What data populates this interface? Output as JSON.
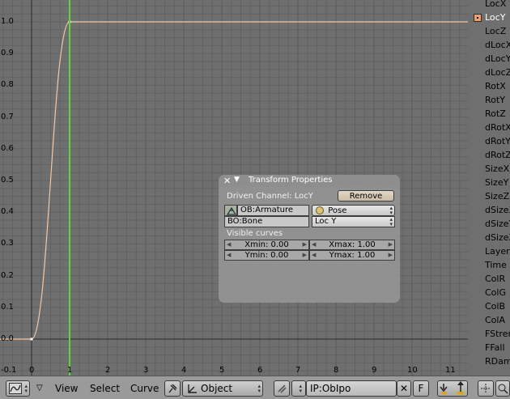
{
  "graph": {
    "y_ticks": [
      "1.0",
      "0.9",
      "0.8",
      "0.7",
      "0.6",
      "0.5",
      "0.4",
      "0.3",
      "0.2",
      "0.1",
      "0.0",
      "-0.1"
    ],
    "x_ticks": [
      "0",
      "1",
      "2",
      "3",
      "4",
      "5",
      "6",
      "7",
      "8",
      "9",
      "10",
      "11"
    ],
    "current_frame": 1,
    "colors": {
      "background": "#6f6f6f",
      "grid": "#626262",
      "axis": "#2a2a2a",
      "curve": "#f5c7a4",
      "frame_line": "#63d33a"
    }
  },
  "channels": [
    {
      "label": "LocX",
      "selected": false
    },
    {
      "label": "LocY",
      "selected": true
    },
    {
      "label": "LocZ",
      "selected": false
    },
    {
      "label": "dLocX",
      "selected": false
    },
    {
      "label": "dLocY",
      "selected": false
    },
    {
      "label": "dLocZ",
      "selected": false
    },
    {
      "label": "RotX",
      "selected": false
    },
    {
      "label": "RotY",
      "selected": false
    },
    {
      "label": "RotZ",
      "selected": false
    },
    {
      "label": "dRotX",
      "selected": false
    },
    {
      "label": "dRotY",
      "selected": false
    },
    {
      "label": "dRotZ",
      "selected": false
    },
    {
      "label": "SizeX",
      "selected": false
    },
    {
      "label": "SizeY",
      "selected": false
    },
    {
      "label": "SizeZ",
      "selected": false
    },
    {
      "label": "dSizeX",
      "selected": false
    },
    {
      "label": "dSizeY",
      "selected": false
    },
    {
      "label": "dSizeZ",
      "selected": false
    },
    {
      "label": "Layer",
      "selected": false
    },
    {
      "label": "Time",
      "selected": false
    },
    {
      "label": "ColR",
      "selected": false
    },
    {
      "label": "ColG",
      "selected": false
    },
    {
      "label": "ColB",
      "selected": false
    },
    {
      "label": "ColA",
      "selected": false
    },
    {
      "label": "FStrength",
      "selected": false
    },
    {
      "label": "FFall",
      "selected": false
    },
    {
      "label": "RDamp",
      "selected": false
    }
  ],
  "panel": {
    "close_glyph": "✕",
    "collapse_glyph": "▼",
    "title": "Transform Properties",
    "driven_channel": "Driven Channel: LocY",
    "remove_label": "Remove",
    "object": "OB:Armature",
    "mode": "Pose",
    "bone": "BO:Bone",
    "channel": "Loc Y",
    "visible_curves_label": "Visible curves",
    "xmin": "Xmin: 0.00",
    "xmax": "Xmax: 1.00",
    "ymin": "Ymin: 0.00",
    "ymax": "Ymax: 1.00"
  },
  "header": {
    "menus": [
      "View",
      "Select",
      "Curve"
    ],
    "object_mode": "Object",
    "ipo_name": "IP:ObIpo",
    "fake_user": "F",
    "close_glyph": "✕"
  }
}
